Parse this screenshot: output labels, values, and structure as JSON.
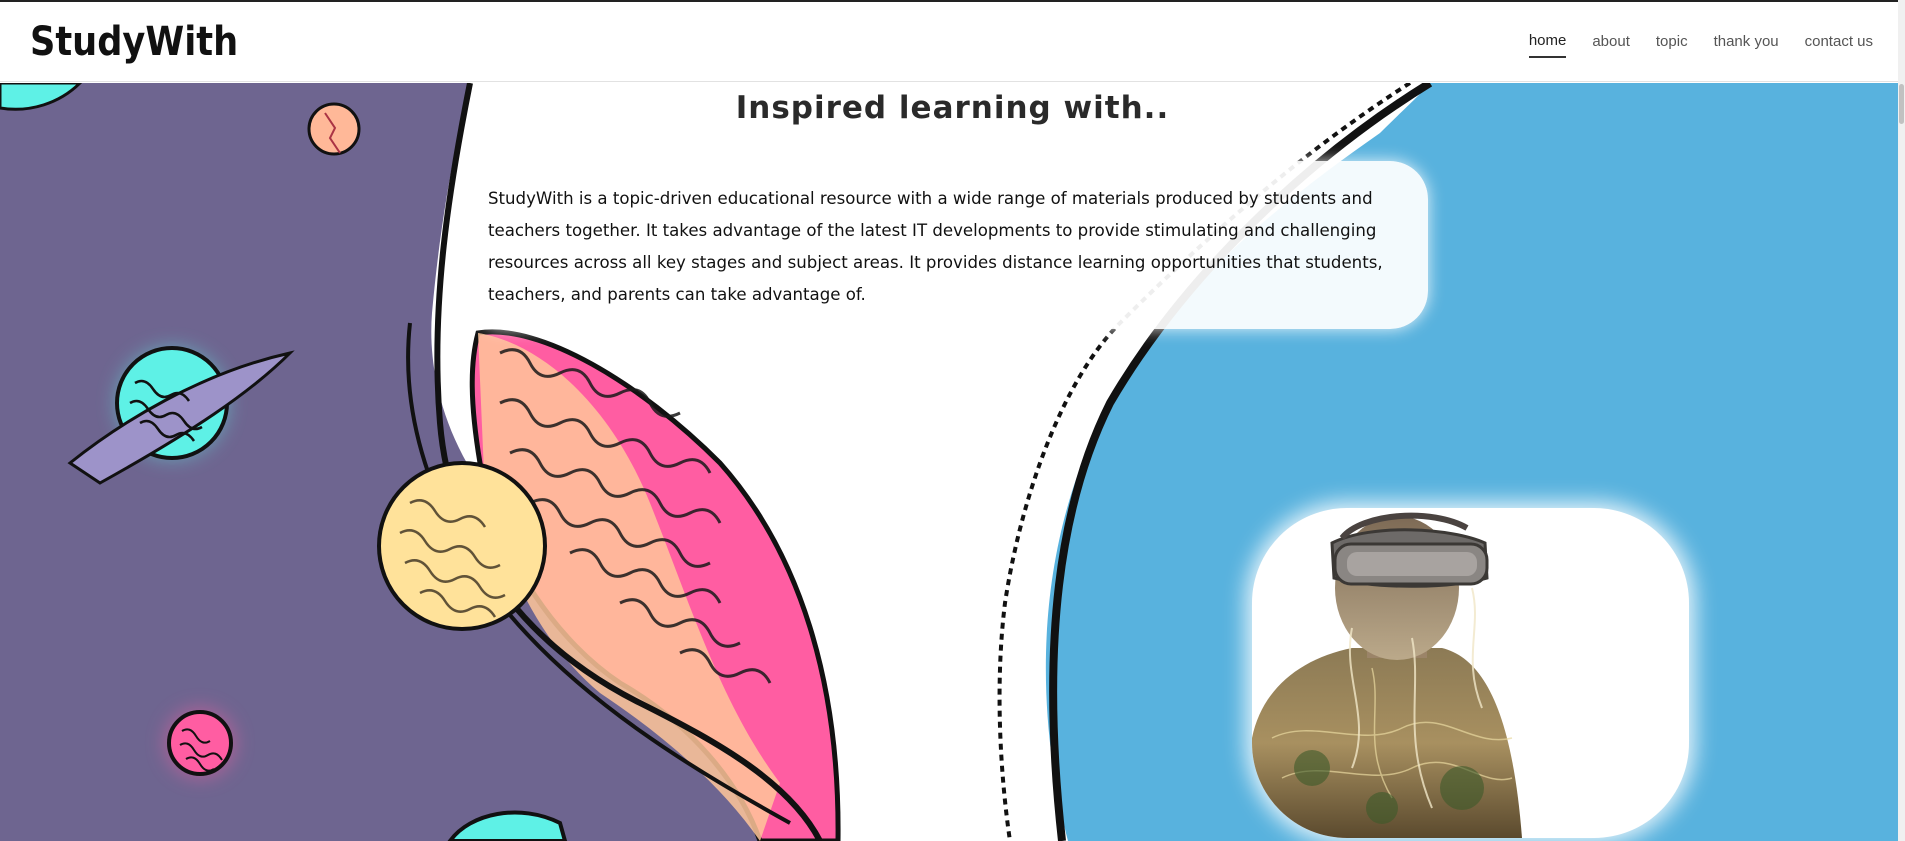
{
  "brand": {
    "name": "StudyWith"
  },
  "nav": {
    "items": [
      {
        "label": "home",
        "active": true
      },
      {
        "label": "about"
      },
      {
        "label": "topic"
      },
      {
        "label": "thank you"
      },
      {
        "label": "contact us"
      }
    ]
  },
  "hero": {
    "headline": "Inspired learning with..",
    "intro": "StudyWith is a topic-driven educational resource with a wide range of materials produced by students and teachers together. It takes advantage of the latest IT developments to provide stimulating and challenging resources across all key stages and subject areas. It provides distance learning opportunities that students, teachers, and parents can take advantage of.",
    "image_subject": "person-wearing-vr-headset"
  },
  "colors": {
    "space_purple": "#6e6590",
    "sky_blue": "#58b2de",
    "planet_pink": "#ff5da2",
    "planet_peach": "#ffc69a",
    "planet_yellow": "#ffe29a",
    "planet_cyan": "#5ef1e6"
  }
}
